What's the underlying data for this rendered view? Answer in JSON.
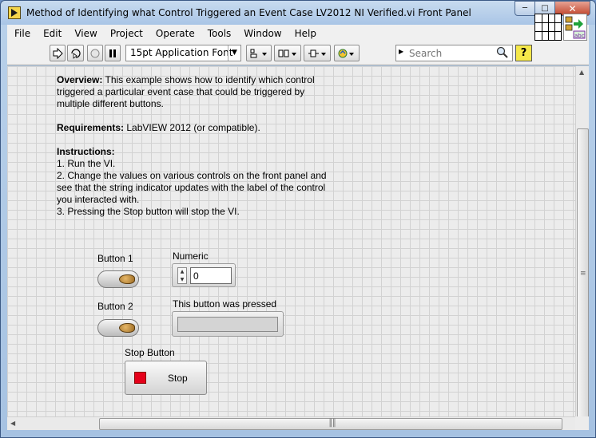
{
  "window": {
    "title": "Method of Identifying what Control Triggered an Event Case LV2012 NI Verified.vi Front Panel"
  },
  "menu": [
    "File",
    "Edit",
    "View",
    "Project",
    "Operate",
    "Tools",
    "Window",
    "Help"
  ],
  "toolbar": {
    "font": "15pt Application Font",
    "search_placeholder": "Search",
    "help_label": "?"
  },
  "panel": {
    "overview_label": "Overview:",
    "overview_text": " This example shows how to identify which control triggered a particular event case that could be triggered by multiple different buttons.",
    "requirements_label": "Requirements:",
    "requirements_text": " LabVIEW 2012 (or compatible).",
    "instructions_label": "Instructions:",
    "instructions": [
      "1. Run the VI.",
      "2. Change the values on various controls on the front panel and see that the string indicator updates with the label of the control you interacted with.",
      "3. Pressing the Stop button will stop the VI."
    ],
    "controls": {
      "button1_label": "Button 1",
      "button2_label": "Button 2",
      "numeric_label": "Numeric",
      "numeric_value": "0",
      "indicator_label": "This button was pressed",
      "indicator_value": "",
      "stop_label": "Stop Button",
      "stop_text": "Stop"
    }
  }
}
